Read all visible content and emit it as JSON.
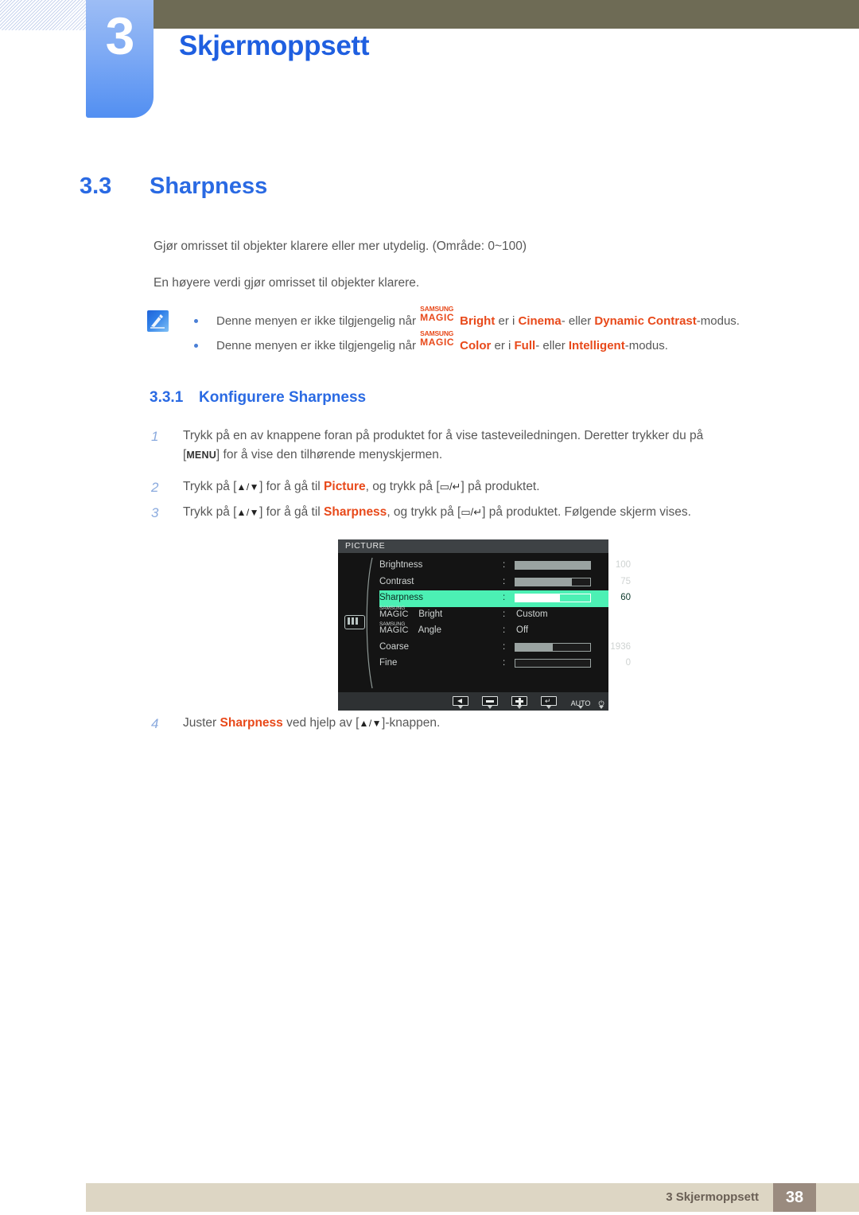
{
  "header": {
    "chapter_number": "3",
    "chapter_title": "Skjermoppsett"
  },
  "section": {
    "number": "3.3",
    "title": "Sharpness"
  },
  "body": {
    "paragraph_1": "Gjør omrisset til objekter klarere eller mer utydelig. (Område: 0~100)",
    "paragraph_2": "En høyere verdi gjør omrisset til objekter klarere."
  },
  "note": {
    "icon": "note-pencil-icon",
    "items": [
      {
        "prefix": "Denne menyen er ikke tilgjengelig når ",
        "magic_top": "SAMSUNG",
        "magic_bottom": "MAGIC",
        "feature": "Bright",
        "mid": " er i ",
        "value_1": "Cinema",
        "between": "- eller ",
        "value_2": "Dynamic Contrast",
        "suffix": "-modus."
      },
      {
        "prefix": "Denne menyen er ikke tilgjengelig når ",
        "magic_top": "SAMSUNG",
        "magic_bottom": "MAGIC",
        "feature": "Color",
        "mid": " er i ",
        "value_1": "Full",
        "between": "- eller ",
        "value_2": "Intelligent",
        "suffix": "-modus."
      }
    ]
  },
  "subsection": {
    "number": "3.3.1",
    "title": "Konfigurere Sharpness"
  },
  "steps": [
    {
      "num": "1",
      "part_a": "Trykk på en av knappene foran på produktet for å vise tasteveiledningen. Deretter trykker du på",
      "key": "MENU",
      "part_b": " for å vise den tilhørende menyskjermen.",
      "open_bracket": "[",
      "close_bracket": "]"
    },
    {
      "num": "2",
      "part_a": "Trykk på [",
      "arrows": "▲/▼",
      "part_b": "] for å gå til ",
      "target": "Picture",
      "part_c": ", og trykk på [",
      "glyphs": "▭/↵",
      "part_d": "] på produktet."
    },
    {
      "num": "3",
      "part_a": "Trykk på [",
      "arrows": "▲/▼",
      "part_b": "] for å gå til ",
      "target": "Sharpness",
      "part_c": ", og trykk på [",
      "glyphs": "▭/↵",
      "part_d": "] på produktet. Følgende skjerm vises."
    },
    {
      "num": "4",
      "part_a": "Juster ",
      "target": "Sharpness",
      "part_b": " ved hjelp av [",
      "arrows": "▲/▼",
      "part_c": "]-knappen."
    }
  ],
  "osd": {
    "title": "PICTURE",
    "sidebar_icon": "picture-menu-icon",
    "rows": [
      {
        "label": "Brightness",
        "colon": ":",
        "type": "bar",
        "fill_pct": 100,
        "value": "100",
        "selected": false
      },
      {
        "label": "Contrast",
        "colon": ":",
        "type": "bar",
        "fill_pct": 75,
        "value": "75",
        "selected": false
      },
      {
        "label": "Sharpness",
        "colon": ":",
        "type": "bar",
        "fill_pct": 60,
        "value": "60",
        "selected": true
      },
      {
        "label": "Bright",
        "colon": ":",
        "type": "text",
        "magic_top": "SAMSUNG",
        "magic_bottom": "MAGIC",
        "value": "Custom",
        "selected": false
      },
      {
        "label": "Angle",
        "colon": ":",
        "type": "text",
        "magic_top": "SAMSUNG",
        "magic_bottom": "MAGIC",
        "value": "Off",
        "selected": false
      },
      {
        "label": "Coarse",
        "colon": ":",
        "type": "bar",
        "fill_pct": 50,
        "value": "1936",
        "selected": false
      },
      {
        "label": "Fine",
        "colon": ":",
        "type": "bar",
        "fill_pct": 0,
        "value": "0",
        "selected": false
      }
    ],
    "footer_buttons": [
      {
        "name": "back-button",
        "glyph": "◀"
      },
      {
        "name": "minus-button",
        "glyph": "▬"
      },
      {
        "name": "plus-button",
        "glyph": "✚"
      },
      {
        "name": "enter-button",
        "glyph": "↵"
      },
      {
        "name": "auto-button",
        "glyph": "AUTO"
      },
      {
        "name": "power-button",
        "glyph": "⏻"
      }
    ]
  },
  "footer": {
    "text": "3 Skjermoppsett",
    "page": "38"
  },
  "colors": {
    "heading_blue": "#2a6ae3",
    "chapter_blue": "#1f5fe0",
    "accent_orange": "#e8491a",
    "olive": "#6e6b55",
    "footer_tan": "#ddd6c4",
    "footer_page_brown": "#9a8b7f",
    "osd_green": "#4cf0b4"
  }
}
